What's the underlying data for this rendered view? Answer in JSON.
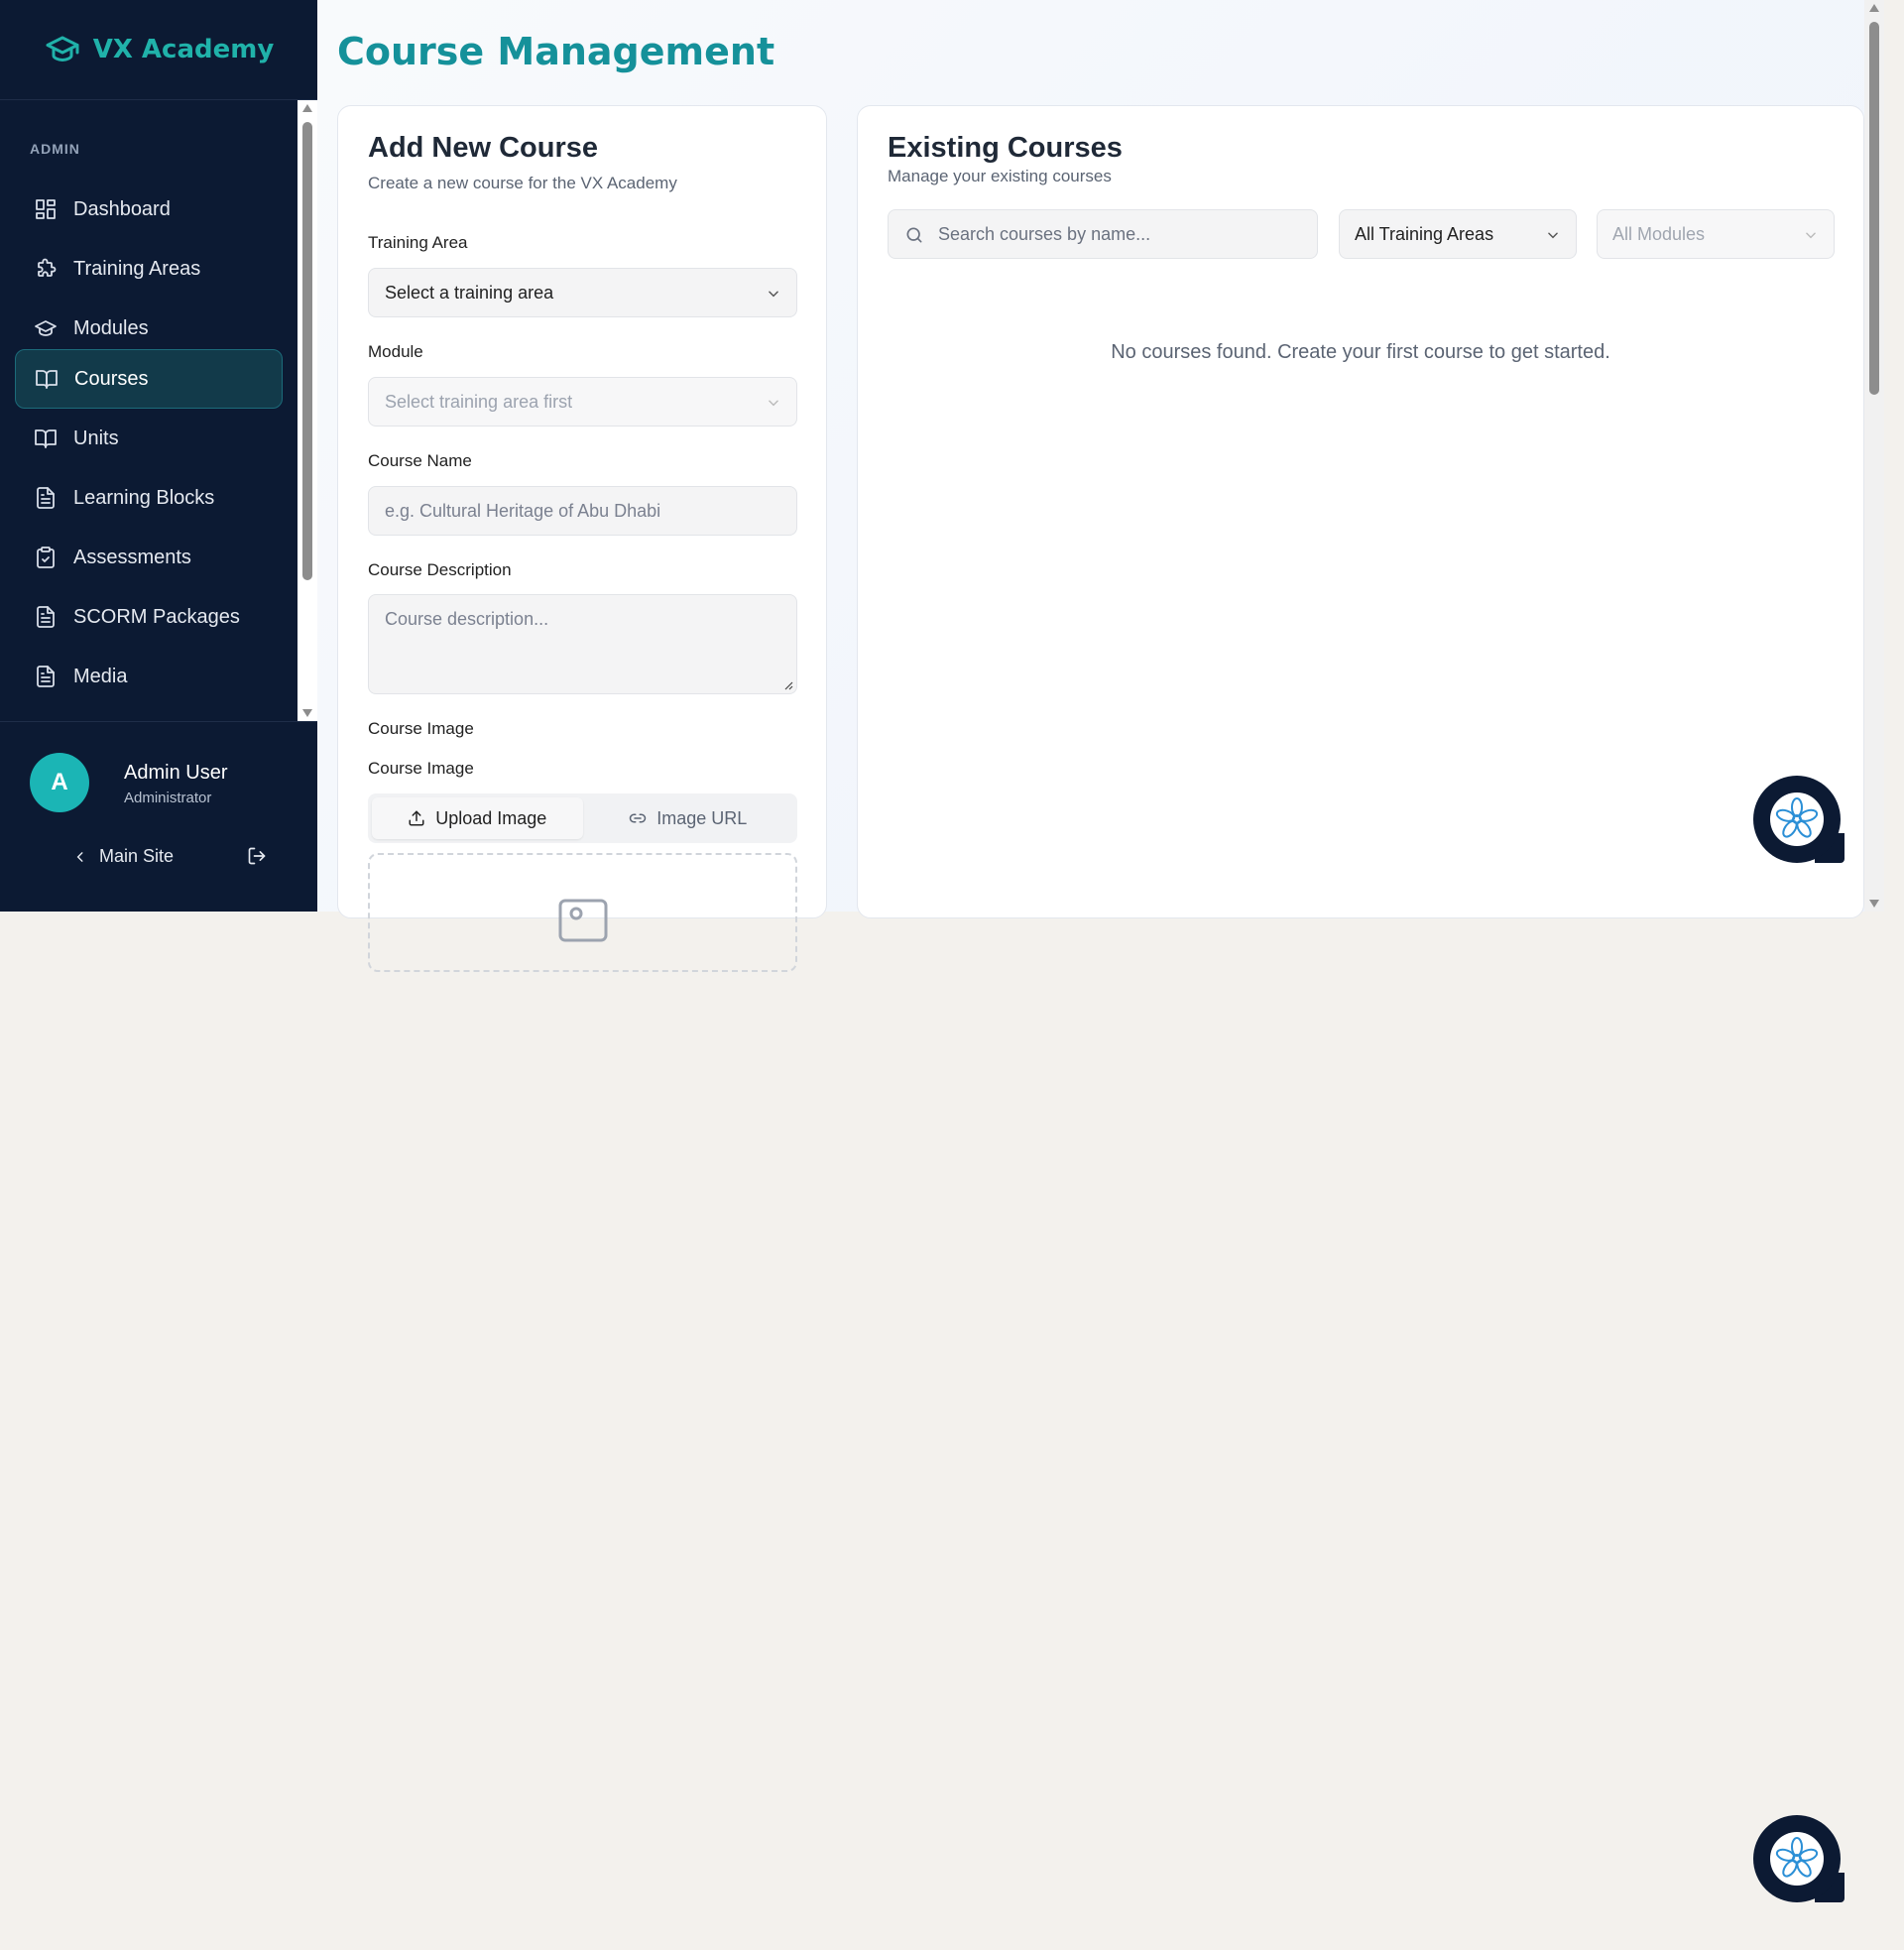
{
  "sidebar": {
    "brand": "VX Academy",
    "section": "ADMIN",
    "items": [
      {
        "label": "Dashboard",
        "icon": "grid-icon"
      },
      {
        "label": "Training Areas",
        "icon": "puzzle-icon"
      },
      {
        "label": "Modules",
        "icon": "graduation-cap-icon"
      },
      {
        "label": "Courses",
        "icon": "book-open-icon",
        "active": true
      },
      {
        "label": "Units",
        "icon": "book-open-icon"
      },
      {
        "label": "Learning Blocks",
        "icon": "file-text-icon"
      },
      {
        "label": "Assessments",
        "icon": "clipboard-check-icon"
      },
      {
        "label": "SCORM Packages",
        "icon": "file-text-icon"
      },
      {
        "label": "Media",
        "icon": "file-text-icon"
      }
    ],
    "user": {
      "initial": "A",
      "name": "Admin User",
      "role": "Administrator"
    },
    "main_site": "Main Site"
  },
  "page": {
    "title": "Course Management"
  },
  "add_course": {
    "title": "Add New Course",
    "subtitle": "Create a new course for the VX Academy",
    "training_area_label": "Training Area",
    "training_area_value": "Select a training area",
    "module_label": "Module",
    "module_value": "Select training area first",
    "course_name_label": "Course Name",
    "course_name_placeholder": "e.g. Cultural Heritage of Abu Dhabi",
    "description_label": "Course Description",
    "description_placeholder": "Course description...",
    "image_label": "Course Image",
    "image_label_2": "Course Image",
    "tabs": [
      "Upload Image",
      "Image URL"
    ]
  },
  "existing": {
    "title": "Existing Courses",
    "subtitle": "Manage your existing courses",
    "search_placeholder": "Search courses by name...",
    "training_filter": "All Training Areas",
    "module_filter": "All Modules",
    "empty": "No courses found. Create your first course to get started."
  },
  "colors": {
    "sidebar_bg": "#0c1a33",
    "accent": "#15919a",
    "active_bg": "#123a4a"
  }
}
